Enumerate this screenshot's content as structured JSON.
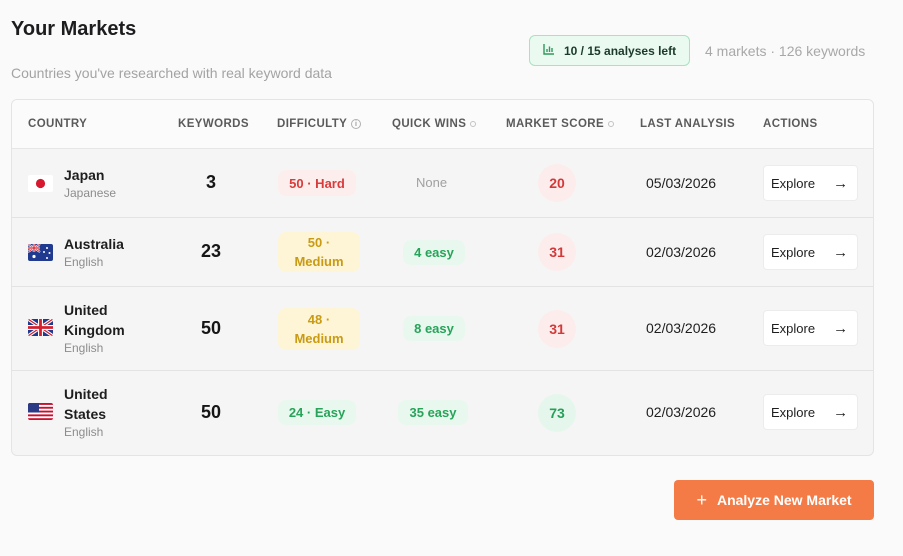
{
  "header": {
    "title": "Your Markets",
    "subtitle": "Countries you've researched with real keyword data",
    "quota": "10 / 15 analyses left",
    "summary": "4 markets · 126 keywords"
  },
  "table": {
    "columns": [
      "COUNTRY",
      "KEYWORDS",
      "DIFFICULTY",
      "QUICK WINS",
      "MARKET SCORE",
      "LAST ANALYSIS",
      "ACTIONS"
    ],
    "rows": [
      {
        "country": "Japan",
        "language": "Japanese",
        "keywords": "3",
        "difficulty": "50 · Hard",
        "quick_wins": "None",
        "score": "20",
        "date": "05/03/2026",
        "action": "Explore"
      },
      {
        "country": "Australia",
        "language": "English",
        "keywords": "23",
        "difficulty_line1": "50 ·",
        "difficulty_line2": "Medium",
        "quick_wins": "4 easy",
        "score": "31",
        "date": "02/03/2026",
        "action": "Explore"
      },
      {
        "country_line1": "United",
        "country_line2": "Kingdom",
        "language": "English",
        "keywords": "50",
        "difficulty_line1": "48 ·",
        "difficulty_line2": "Medium",
        "quick_wins": "8 easy",
        "score": "31",
        "date": "02/03/2026",
        "action": "Explore"
      },
      {
        "country_line1": "United",
        "country_line2": "States",
        "language": "English",
        "keywords": "50",
        "difficulty": "24 · Easy",
        "quick_wins": "35 easy",
        "score": "73",
        "date": "02/03/2026",
        "action": "Explore"
      }
    ]
  },
  "cta": {
    "label": "Analyze New Market"
  },
  "colors": {
    "accent": "#f47b45",
    "hard": "#d93a3a",
    "medium": "#c99a12",
    "easy": "#27a35a"
  },
  "icons": [
    "bar-chart-icon",
    "info-icon",
    "arrow-right-icon",
    "plus-icon"
  ]
}
